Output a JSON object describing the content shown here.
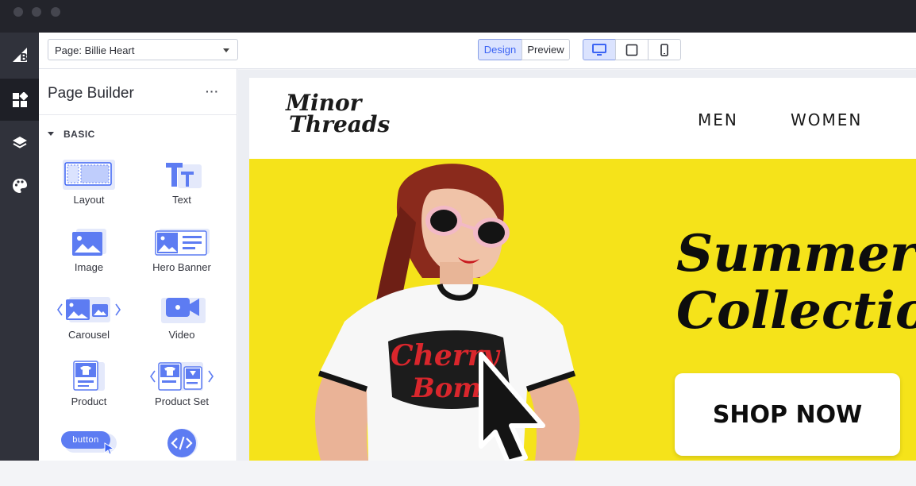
{
  "topbar": {
    "page_selector": "Page:  Billie Heart",
    "design_label": "Design",
    "preview_label": "Preview"
  },
  "sidebar": {
    "title": "Page Builder",
    "more": "···",
    "section": "BASIC",
    "widgets": [
      {
        "label": "Layout",
        "icon": "layout-icon"
      },
      {
        "label": "Text",
        "icon": "text-icon"
      },
      {
        "label": "Image",
        "icon": "image-icon"
      },
      {
        "label": "Hero Banner",
        "icon": "hero-banner-icon"
      },
      {
        "label": "Carousel",
        "icon": "carousel-icon"
      },
      {
        "label": "Video",
        "icon": "video-icon"
      },
      {
        "label": "Product",
        "icon": "product-icon"
      },
      {
        "label": "Product Set",
        "icon": "product-set-icon"
      },
      {
        "label": "button",
        "icon": "button-icon"
      },
      {
        "label": "",
        "icon": "html-code-icon"
      }
    ]
  },
  "site": {
    "logo_line1": "Minor",
    "logo_line2": "Threads",
    "nav": [
      "MEN",
      "WOMEN"
    ],
    "headline_line1": "Summer",
    "headline_line2": "Collectio",
    "cta": "SHOP NOW",
    "shirt_text_1": "Cherry",
    "shirt_text_2": "Bomb"
  },
  "colors": {
    "accent": "#3c64f4",
    "hero_bg": "#f5e31a",
    "rail_bg": "#30323b"
  }
}
